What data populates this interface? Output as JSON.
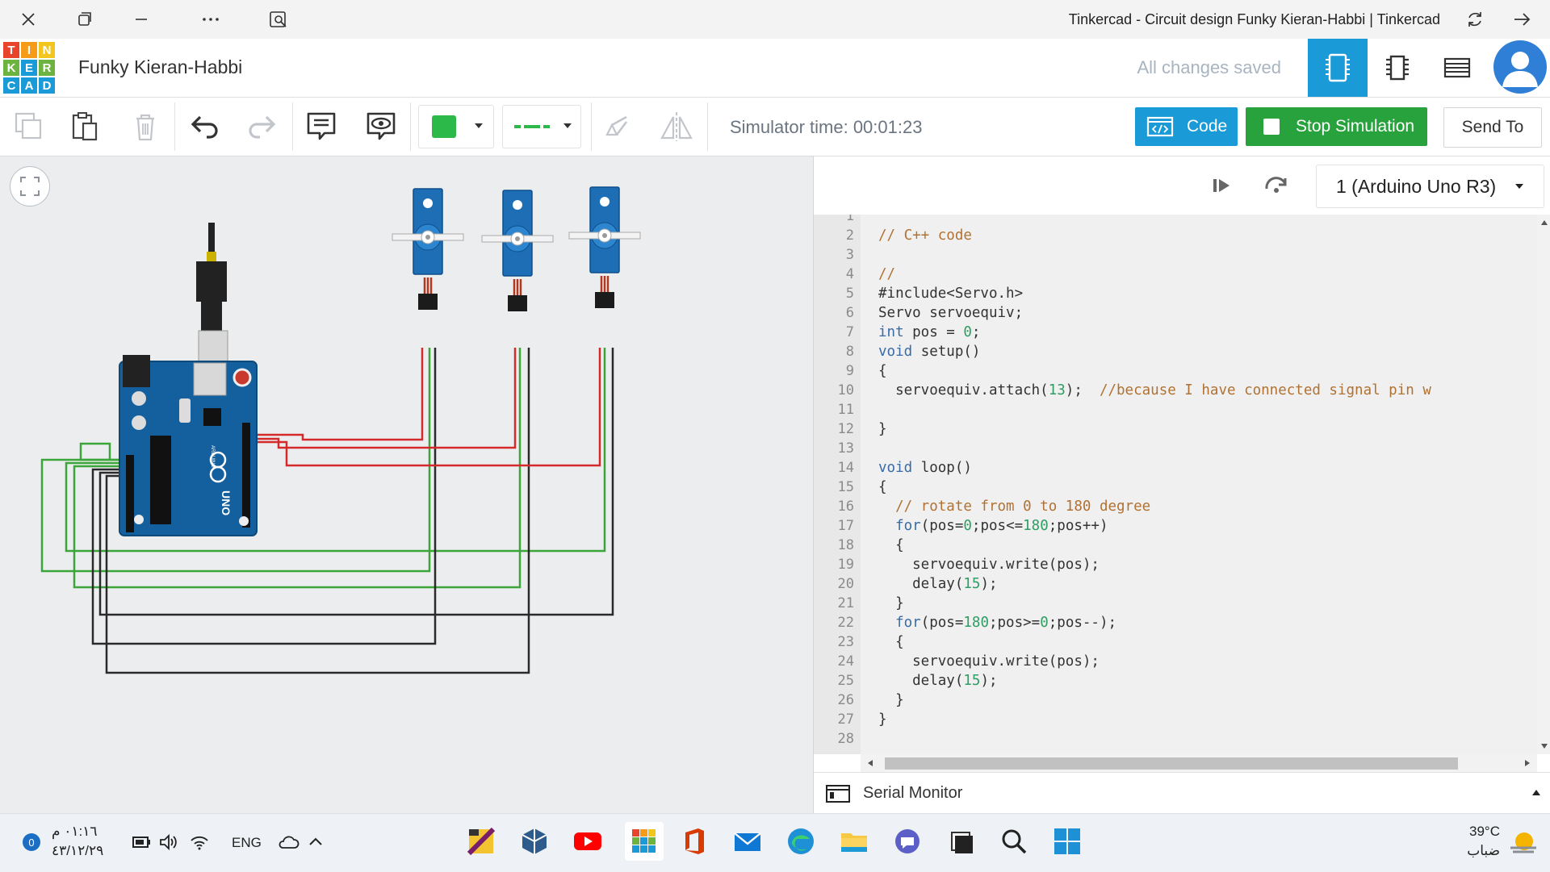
{
  "window": {
    "title": "Tinkercad - Circuit design Funky Kieran-Habbi | Tinkercad"
  },
  "header": {
    "logo_letters": [
      "T",
      "I",
      "N",
      "K",
      "E",
      "R",
      "C",
      "A",
      "D"
    ],
    "project_name": "Funky Kieran-Habbi",
    "save_status": "All changes saved"
  },
  "toolbar": {
    "color_swatch": "#2db84a",
    "simulator_time": "Simulator time: 00:01:23",
    "code_label": "Code",
    "stop_label": "Stop Simulation",
    "send_to_label": "Send To"
  },
  "code_panel": {
    "device_selected": "1 (Arduino Uno R3)",
    "line_numbers": [
      "1",
      "2",
      "3",
      "4",
      "5",
      "6",
      "7",
      "8",
      "9",
      "10",
      "11",
      "12",
      "13",
      "14",
      "15",
      "16",
      "17",
      "18",
      "19",
      "20",
      "21",
      "22",
      "23",
      "24",
      "25",
      "26",
      "27",
      "28"
    ],
    "code_lines": [
      "",
      "// C++ code",
      "",
      "//",
      "#include<Servo.h>",
      "Servo servoequiv;",
      "int pos = 0;",
      "void setup()",
      "{",
      "  servoequiv.attach(13);  //because I have connected signal pin w",
      "",
      "}",
      "",
      "void loop()",
      "{",
      "  // rotate from 0 to 180 degree",
      "  for(pos=0;pos<=180;pos++)",
      "  {",
      "    servoequiv.write(pos);",
      "    delay(15);",
      "  }",
      "  for(pos=180;pos>=0;pos--);",
      "  {",
      "    servoequiv.write(pos);",
      "    delay(15);",
      "  }",
      "}",
      ""
    ],
    "serial_monitor_label": "Serial Monitor"
  },
  "circuit": {
    "board_label": "UNO",
    "board_brand": "ARDUINO",
    "servo_count": 3,
    "wire_colors": {
      "signal": "#d42a2a",
      "power": "#3aa63a",
      "ground": "#2a2a2a"
    }
  },
  "taskbar": {
    "time": "٠١:١٦ م",
    "date": "٤٣/١٢/٢٩",
    "notification_count": "0",
    "language": "ENG",
    "temperature": "39°C",
    "weather": "ضباب"
  },
  "colors": {
    "accent_blue": "#1a9ad7",
    "stop_green": "#27a23c"
  }
}
